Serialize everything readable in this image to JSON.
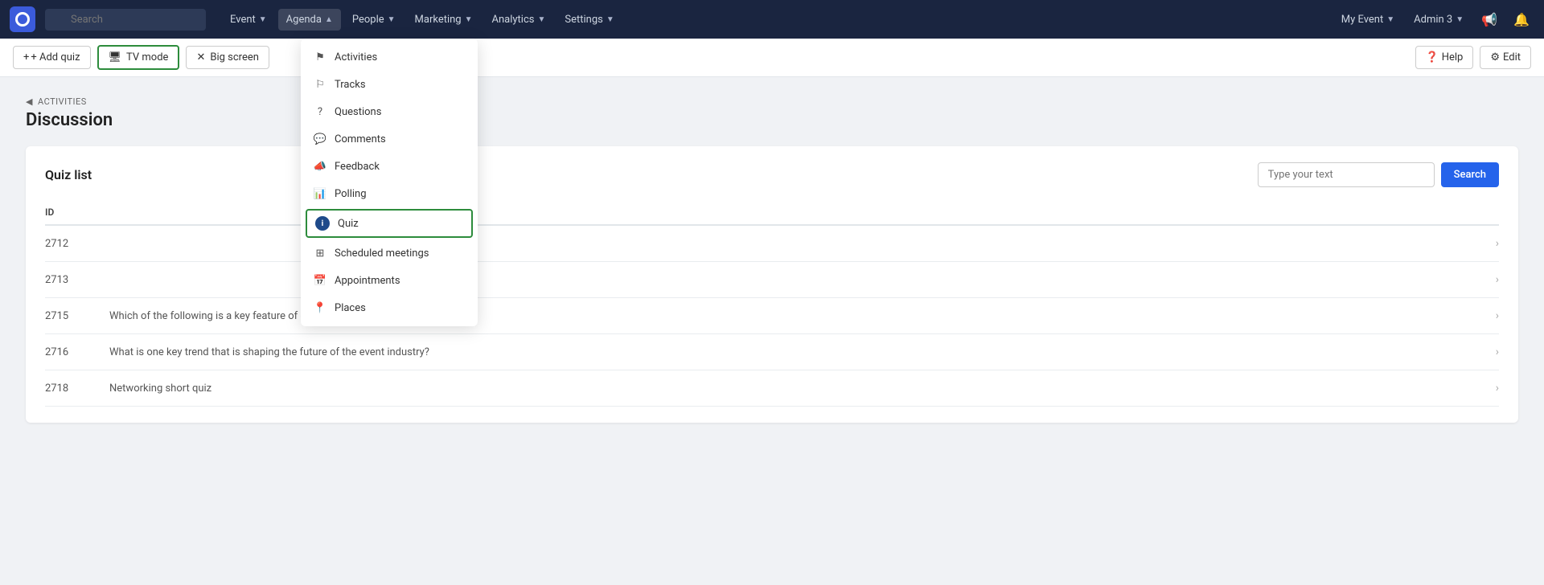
{
  "navbar": {
    "logo_alt": "App Logo",
    "search_placeholder": "Search",
    "nav_items": [
      {
        "id": "event",
        "label": "Event",
        "has_dropdown": true
      },
      {
        "id": "agenda",
        "label": "Agenda",
        "has_dropdown": true,
        "active": true
      },
      {
        "id": "people",
        "label": "People",
        "has_dropdown": true
      },
      {
        "id": "marketing",
        "label": "Marketing",
        "has_dropdown": true
      },
      {
        "id": "analytics",
        "label": "Analytics",
        "has_dropdown": true
      },
      {
        "id": "settings",
        "label": "Settings",
        "has_dropdown": true
      }
    ],
    "my_event_label": "My Event",
    "admin_label": "Admin 3"
  },
  "toolbar": {
    "add_quiz_label": "+ Add quiz",
    "tv_mode_label": "TV mode",
    "big_screen_label": "Big screen",
    "help_label": "Help",
    "edit_label": "Edit"
  },
  "breadcrumb": {
    "parent": "ACTIVITIES",
    "current": "Discussion"
  },
  "quiz_panel": {
    "title": "Quiz list",
    "search_placeholder": "Type your text",
    "search_button": "Search",
    "columns": {
      "id": "ID",
      "question": ""
    },
    "rows": [
      {
        "id": "2712",
        "question": ""
      },
      {
        "id": "2713",
        "question": ""
      },
      {
        "id": "2715",
        "question": "Which of the following is a key feature of event registration platforms?"
      },
      {
        "id": "2716",
        "question": "What is one key trend that is shaping the future of the event industry?"
      },
      {
        "id": "2718",
        "question": "Networking short quiz"
      }
    ]
  },
  "dropdown": {
    "items": [
      {
        "id": "activities",
        "label": "Activities",
        "icon": "flag"
      },
      {
        "id": "tracks",
        "label": "Tracks",
        "icon": "flag-outline"
      },
      {
        "id": "questions",
        "label": "Questions",
        "icon": "question-circle"
      },
      {
        "id": "comments",
        "label": "Comments",
        "icon": "chat"
      },
      {
        "id": "feedback",
        "label": "Feedback",
        "icon": "megaphone"
      },
      {
        "id": "polling",
        "label": "Polling",
        "icon": "bar-chart"
      },
      {
        "id": "quiz",
        "label": "Quiz",
        "icon": "quiz-badge",
        "selected": true
      },
      {
        "id": "scheduled-meetings",
        "label": "Scheduled meetings",
        "icon": "grid"
      },
      {
        "id": "appointments",
        "label": "Appointments",
        "icon": "calendar"
      },
      {
        "id": "places",
        "label": "Places",
        "icon": "map-pin"
      }
    ]
  }
}
